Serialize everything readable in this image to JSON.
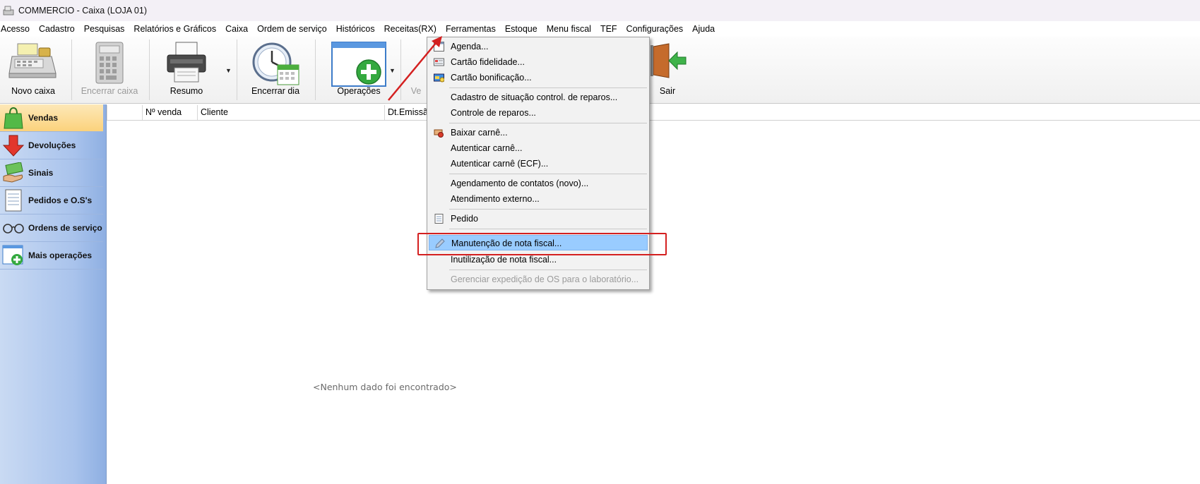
{
  "window": {
    "title": "COMMERCIO - Caixa (LOJA 01)"
  },
  "menubar": [
    "Acesso",
    "Cadastro",
    "Pesquisas",
    "Relatórios e Gráficos",
    "Caixa",
    "Ordem de serviço",
    "Históricos",
    "Receitas(RX)",
    "Ferramentas",
    "Estoque",
    "Menu fiscal",
    "TEF",
    "Configurações",
    "Ajuda"
  ],
  "toolbar": {
    "novo_caixa": "Novo caixa",
    "encerrar_caixa": "Encerrar caixa",
    "resumo": "Resumo",
    "encerrar_dia": "Encerrar dia",
    "operacoes": "Operações",
    "partial": "Ve",
    "sair": "Sair"
  },
  "sidebar": {
    "items": [
      {
        "label": "Vendas",
        "selected": true
      },
      {
        "label": "Devoluções"
      },
      {
        "label": "Sinais"
      },
      {
        "label": "Pedidos e O.S's"
      },
      {
        "label": "Ordens de serviço"
      },
      {
        "label": "Mais operações"
      }
    ]
  },
  "grid": {
    "columns": [
      "Nº venda",
      "Cliente",
      "Dt.Emissã"
    ],
    "empty_message": "<Nenhum dado foi encontrado>"
  },
  "dropdown": {
    "items": [
      {
        "label": "Agenda...",
        "icon": "calendar-icon"
      },
      {
        "label": "Cartão fidelidade...",
        "icon": "card-icon"
      },
      {
        "label": "Cartão bonificação...",
        "icon": "bonus-card-icon"
      },
      {
        "label": "Cadastro de situação control. de reparos..."
      },
      {
        "label": "Controle de reparos..."
      },
      {
        "label": "Baixar carnê...",
        "icon": "payment-icon"
      },
      {
        "label": "Autenticar carnê..."
      },
      {
        "label": "Autenticar carnê (ECF)..."
      },
      {
        "label": "Agendamento de contatos (novo)..."
      },
      {
        "label": "Atendimento externo..."
      },
      {
        "label": "Pedido",
        "icon": "document-icon"
      },
      {
        "label": "Manutenção de nota fiscal...",
        "icon": "pencil-icon",
        "highlighted": true
      },
      {
        "label": "Inutilização de nota fiscal..."
      },
      {
        "label": "Gerenciar expedição de OS para o laboratório...",
        "disabled": true
      }
    ]
  },
  "colors": {
    "highlight": "#99ccff",
    "annotation": "#d42020",
    "sidebar": "#a9c3ec"
  }
}
